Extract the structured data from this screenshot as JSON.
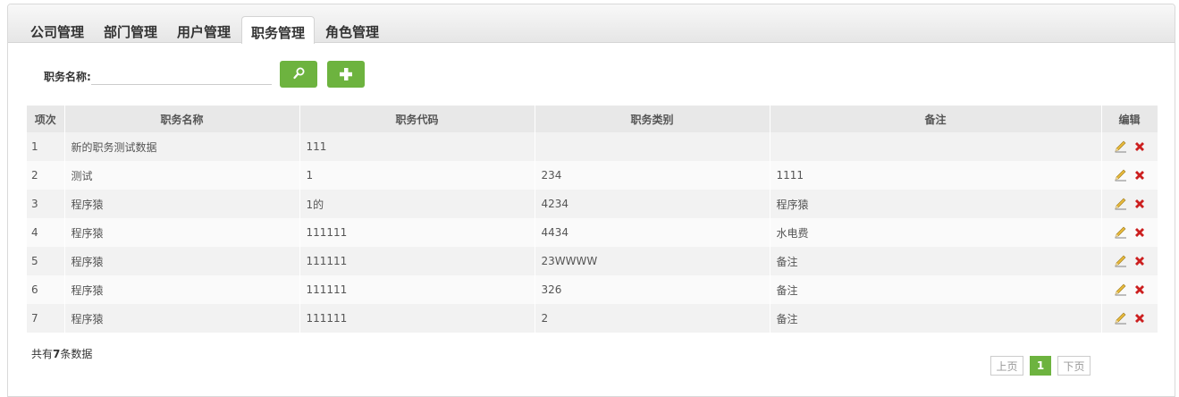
{
  "tabs": [
    {
      "label": "公司管理"
    },
    {
      "label": "部门管理"
    },
    {
      "label": "用户管理"
    },
    {
      "label": "职务管理",
      "active": true
    },
    {
      "label": "角色管理"
    }
  ],
  "search": {
    "label": "职务名称:",
    "value": "",
    "search_icon": "magnifier-icon",
    "add_icon": "plus-icon"
  },
  "table": {
    "headers": [
      "项次",
      "职务名称",
      "职务代码",
      "职务类别",
      "备注",
      "编辑"
    ],
    "rows": [
      [
        "1",
        "新的职务测试数据",
        "111",
        "",
        ""
      ],
      [
        "2",
        "测试",
        "1",
        "234",
        "1111"
      ],
      [
        "3",
        "程序猿",
        "1的",
        "4234",
        "程序猿"
      ],
      [
        "4",
        "程序猿",
        "111111",
        "4434",
        "水电费"
      ],
      [
        "5",
        "程序猿",
        "111111",
        "23WWWW",
        "备注"
      ],
      [
        "6",
        "程序猿",
        "111111",
        "326",
        "备注"
      ],
      [
        "7",
        "程序猿",
        "111111",
        "2",
        "备注"
      ]
    ],
    "edit_icon": "pencil-icon",
    "delete_icon": "red-x-icon"
  },
  "footer": {
    "total_prefix": "共有",
    "total_count": "7",
    "total_suffix": "条数据"
  },
  "pager": {
    "prev": "上页",
    "current": "1",
    "next": "下页"
  },
  "colors": {
    "accent_green": "#6db33f",
    "delete_red": "#cc1f1f",
    "pencil_yellow": "#e8b93a"
  }
}
